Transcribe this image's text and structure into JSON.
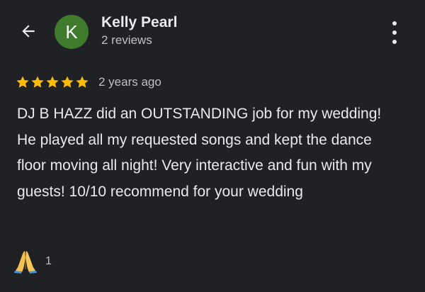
{
  "header": {
    "back_icon": "arrow-back-icon",
    "avatar_letter": "K",
    "avatar_color": "#3f7a2d",
    "reviewer_name": "Kelly Pearl",
    "review_count": "2 reviews",
    "more_icon": "more-vert-icon"
  },
  "review": {
    "rating": 5,
    "rating_max": 5,
    "star_color": "#fbbc04",
    "time_ago": "2 years ago",
    "text": "DJ B HAZZ did an OUTSTANDING job for my wedding! He played all my requested songs and kept the dance floor moving all night! Very interactive and fun with my guests! 10/10 recommend for your wedding"
  },
  "reaction": {
    "icon": "folded-hands-icon",
    "count": "1"
  }
}
